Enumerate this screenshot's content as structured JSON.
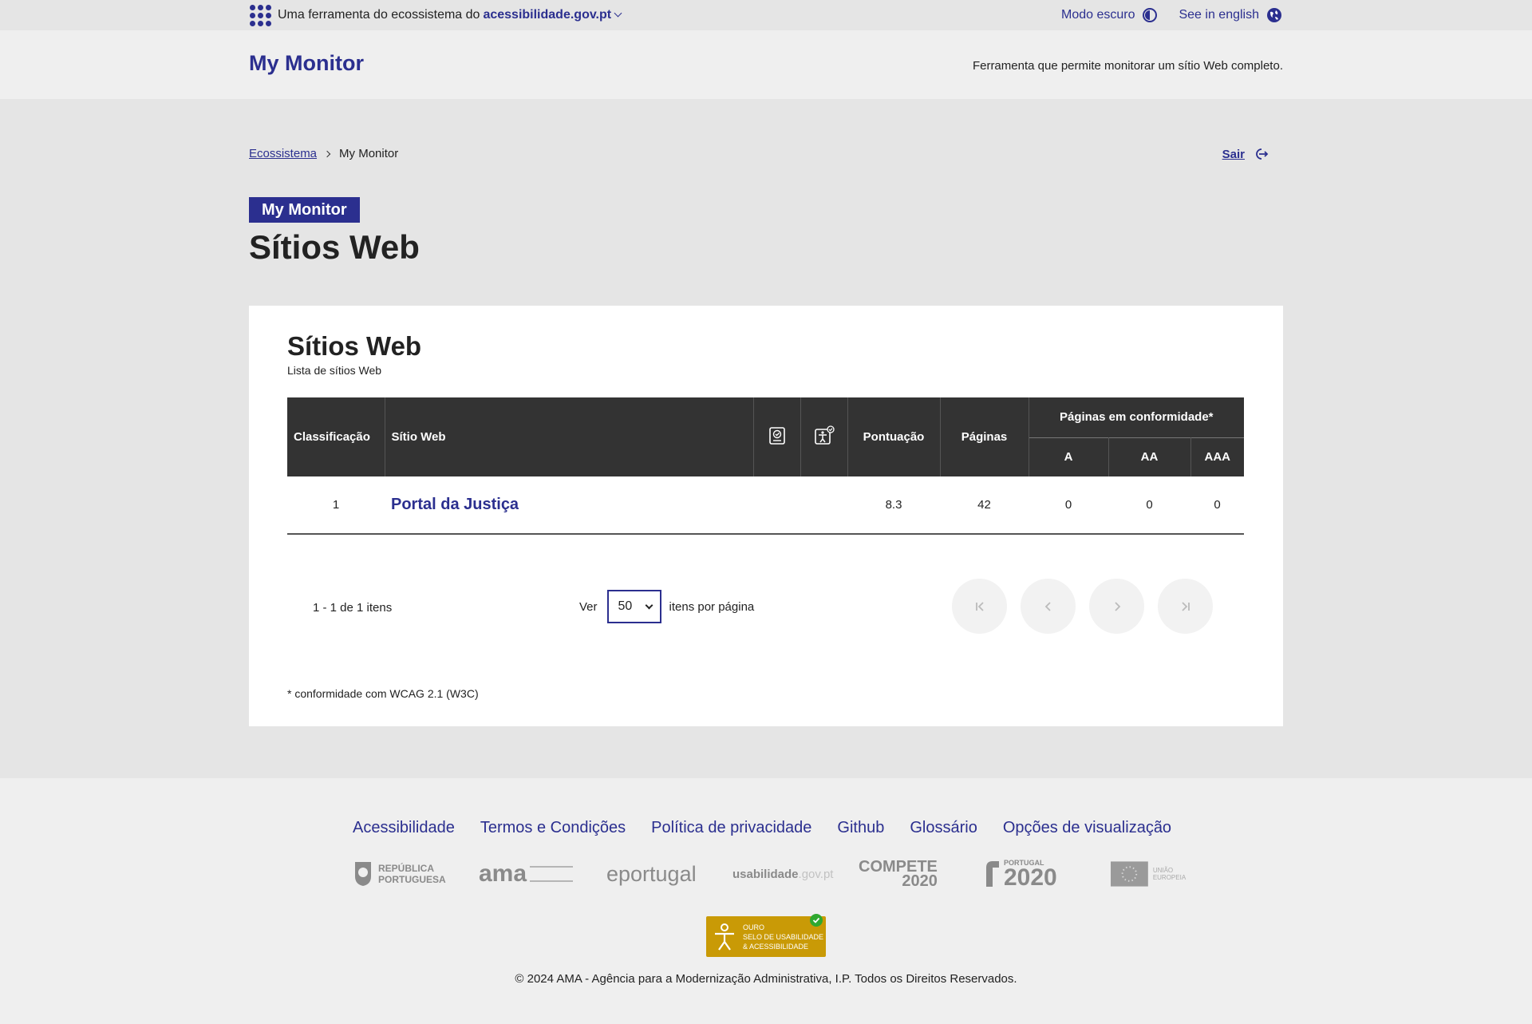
{
  "topbar": {
    "prefix": "Uma ferramenta do ecossistema do",
    "ecosystem_link": "acessibilidade.gov.pt",
    "dark_mode": "Modo escuro",
    "language": "See in english"
  },
  "header": {
    "brand": "My Monitor",
    "tagline": "Ferramenta que permite monitorar um sítio Web completo."
  },
  "breadcrumb": {
    "home": "Ecossistema",
    "current": "My Monitor"
  },
  "logout_label": "Sair",
  "page": {
    "badge": "My Monitor",
    "title": "Sítios Web"
  },
  "card": {
    "title": "Sítios Web",
    "subtitle": "Lista de sítios Web"
  },
  "table": {
    "headers": {
      "rank": "Classificação",
      "site": "Sítio Web",
      "declaration_icon": "accessibility-declaration-icon",
      "seal_icon": "usability-seal-icon",
      "score": "Pontuação",
      "pages": "Páginas",
      "conformity_group": "Páginas em conformidade*",
      "a": "A",
      "aa": "AA",
      "aaa": "AAA"
    },
    "rows": [
      {
        "rank": "1",
        "site": "Portal da Justiça",
        "score": "8.3",
        "pages": "42",
        "a": "0",
        "aa": "0",
        "aaa": "0"
      }
    ]
  },
  "pagination": {
    "range": "1 - 1 de 1 itens",
    "show_label": "Ver",
    "per_page_value": "50",
    "per_page_suffix": "itens por página"
  },
  "footnote": "* conformidade com WCAG 2.1 (W3C)",
  "footer": {
    "links": [
      "Acessibilidade",
      "Termos e Condições",
      "Política de privacidade",
      "Github",
      "Glossário",
      "Opções de visualização"
    ],
    "logos": {
      "republica_1": "REPÚBLICA",
      "republica_2": "PORTUGUESA",
      "ama": "ama",
      "eportugal": "eportugal",
      "usabilidade": "usabilidade",
      "usabilidade_domain": ".gov.pt",
      "compete_1": "COMPETE",
      "compete_2": "2020",
      "portugal_small": "PORTUGAL",
      "portugal_big": "2020",
      "ue": "UNIÃO EUROPEIA"
    },
    "seal": {
      "line1": "OURO",
      "line2": "SELO DE USABILIDADE",
      "line3": "& ACESSIBILIDADE"
    },
    "copyright": "© 2024 AMA - Agência para a Modernização Administrativa, I.P. Todos os Direitos Reservados."
  },
  "colors": {
    "primary": "#2b2f8f",
    "table_header": "#333333",
    "page_bg": "#e5e5e5",
    "gold_seal": "#c99a06"
  }
}
